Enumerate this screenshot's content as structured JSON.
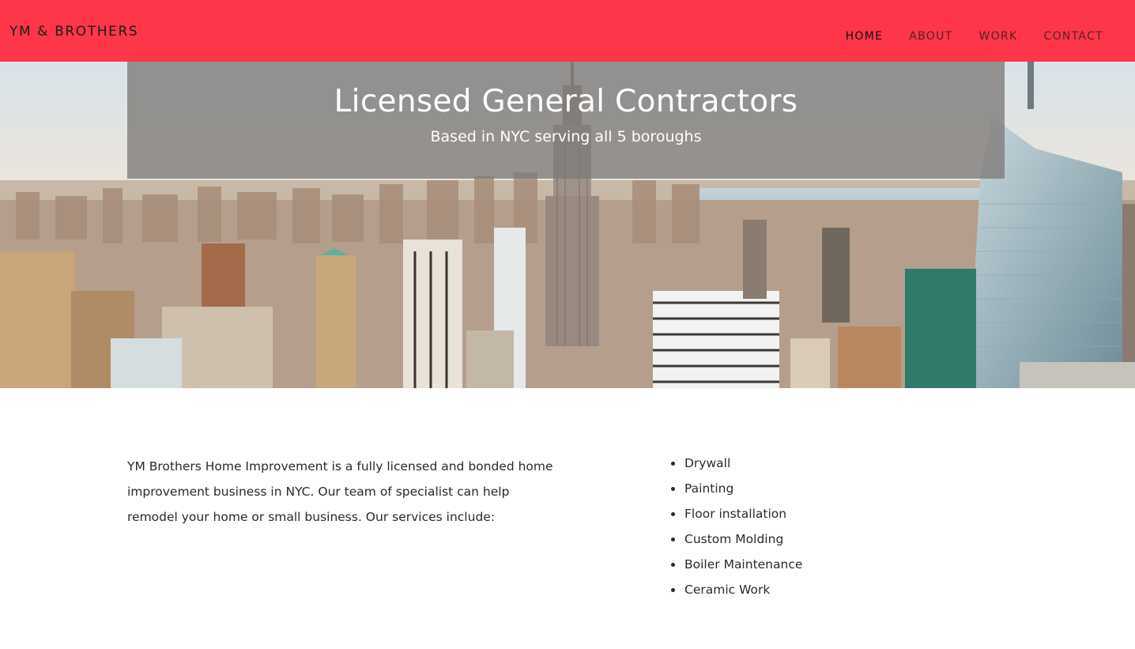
{
  "header": {
    "brand": "YM & BROTHERS",
    "nav": [
      {
        "label": "HOME",
        "active": true
      },
      {
        "label": "ABOUT",
        "active": false
      },
      {
        "label": "WORK",
        "active": false
      },
      {
        "label": "CONTACT",
        "active": false
      }
    ],
    "bar_color": "#fd3649"
  },
  "hero": {
    "title": "Licensed General Contractors",
    "subtitle": "Based in NYC serving all 5 boroughs",
    "background": "new-york-skyline-photo"
  },
  "main": {
    "intro": "YM Brothers Home Improvement is a fully licensed and bonded home improvement business in NYC. Our team of specialist can help remodel your home or small business. Our services include:",
    "services": [
      "Drywall",
      "Painting",
      "Floor installation",
      "Custom Molding",
      "Boiler Maintenance",
      "Ceramic Work"
    ]
  }
}
